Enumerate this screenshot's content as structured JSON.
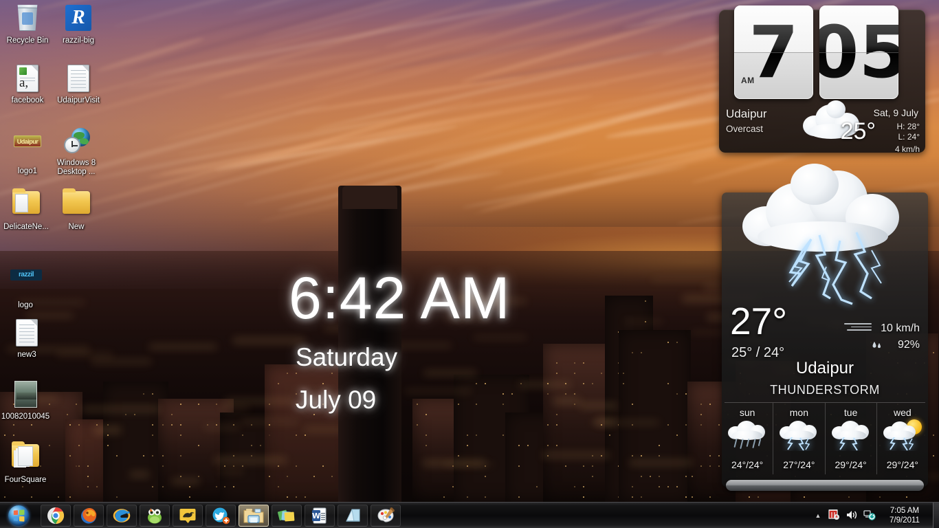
{
  "desktop": {
    "icons": [
      {
        "label": "Recycle Bin",
        "icon": "recycle-bin-icon"
      },
      {
        "label": "razzil-big",
        "icon": "razzil-app-icon"
      },
      {
        "label": "facebook",
        "icon": "document-icon"
      },
      {
        "label": "UdaipurVisit",
        "icon": "text-document-icon"
      },
      {
        "label": "logo1",
        "icon": "image-logo-icon"
      },
      {
        "label": "Windows 8 Desktop ...",
        "icon": "globe-clock-icon"
      },
      {
        "label": "DelicateNe...",
        "icon": "open-folder-icon"
      },
      {
        "label": "New",
        "icon": "folder-icon"
      },
      {
        "label": "logo",
        "icon": "razzil-logo-icon"
      },
      {
        "label": "new3",
        "icon": "text-document-icon"
      },
      {
        "label": "10082010045",
        "icon": "photo-thumbnail-icon"
      },
      {
        "label": "FourSquare",
        "icon": "documents-folder-icon"
      }
    ]
  },
  "center_clock": {
    "time": "6:42 AM",
    "weekday": "Saturday",
    "date": "July 09"
  },
  "htc_widget": {
    "hour": "7",
    "minute": "05",
    "meridiem": "AM",
    "city": "Udaipur",
    "condition": "Overcast",
    "date": "Sat, 9 July",
    "temperature": "25°",
    "high": "H: 28°",
    "low": "L: 24°",
    "wind": "4 km/h",
    "weather_icon": "overcast-cloud-icon"
  },
  "weather_widget": {
    "temperature": "27°",
    "high_low": "25° / 24°",
    "wind": "10 km/h",
    "humidity": "92%",
    "city": "Udaipur",
    "condition": "THUNDERSTORM",
    "weather_icon": "thunderstorm-icon",
    "forecast": [
      {
        "day": "sun",
        "temps": "24°/24°",
        "icon": "rain-cloud-icon"
      },
      {
        "day": "mon",
        "temps": "27°/24°",
        "icon": "thunderstorm-icon"
      },
      {
        "day": "tue",
        "temps": "29°/24°",
        "icon": "thunderstorm-icon"
      },
      {
        "day": "wed",
        "temps": "29°/24°",
        "icon": "sun-thunderstorm-icon"
      }
    ]
  },
  "taskbar": {
    "start_label": "Start",
    "start_icon": "windows-orb-icon",
    "buttons": [
      {
        "name": "chrome",
        "icon": "google-chrome-icon",
        "state": "pinned"
      },
      {
        "name": "firefox",
        "icon": "mozilla-firefox-icon",
        "state": "pinned"
      },
      {
        "name": "ie",
        "icon": "internet-explorer-icon",
        "state": "pinned"
      },
      {
        "name": "frog",
        "icon": "green-frog-icon",
        "state": "pinned"
      },
      {
        "name": "bird",
        "icon": "yellow-bird-icon",
        "state": "pinned"
      },
      {
        "name": "tweetdeck",
        "icon": "twitter-add-icon",
        "state": "pinned"
      },
      {
        "name": "explorer",
        "icon": "windows-explorer-icon",
        "state": "active"
      },
      {
        "name": "gallery",
        "icon": "photo-gallery-icon",
        "state": "pinned"
      },
      {
        "name": "word",
        "icon": "microsoft-word-icon",
        "state": "pinned"
      },
      {
        "name": "notepad",
        "icon": "notepad-icon",
        "state": "pinned"
      },
      {
        "name": "paint",
        "icon": "ms-paint-icon",
        "state": "pinned"
      }
    ],
    "tray": {
      "overflow_icon": "show-hidden-icons-arrow",
      "icons": [
        {
          "name": "action-center-flag-icon"
        },
        {
          "name": "volume-speaker-icon"
        },
        {
          "name": "network-sync-icon"
        }
      ],
      "time": "7:05 AM",
      "date": "7/9/2011"
    }
  }
}
